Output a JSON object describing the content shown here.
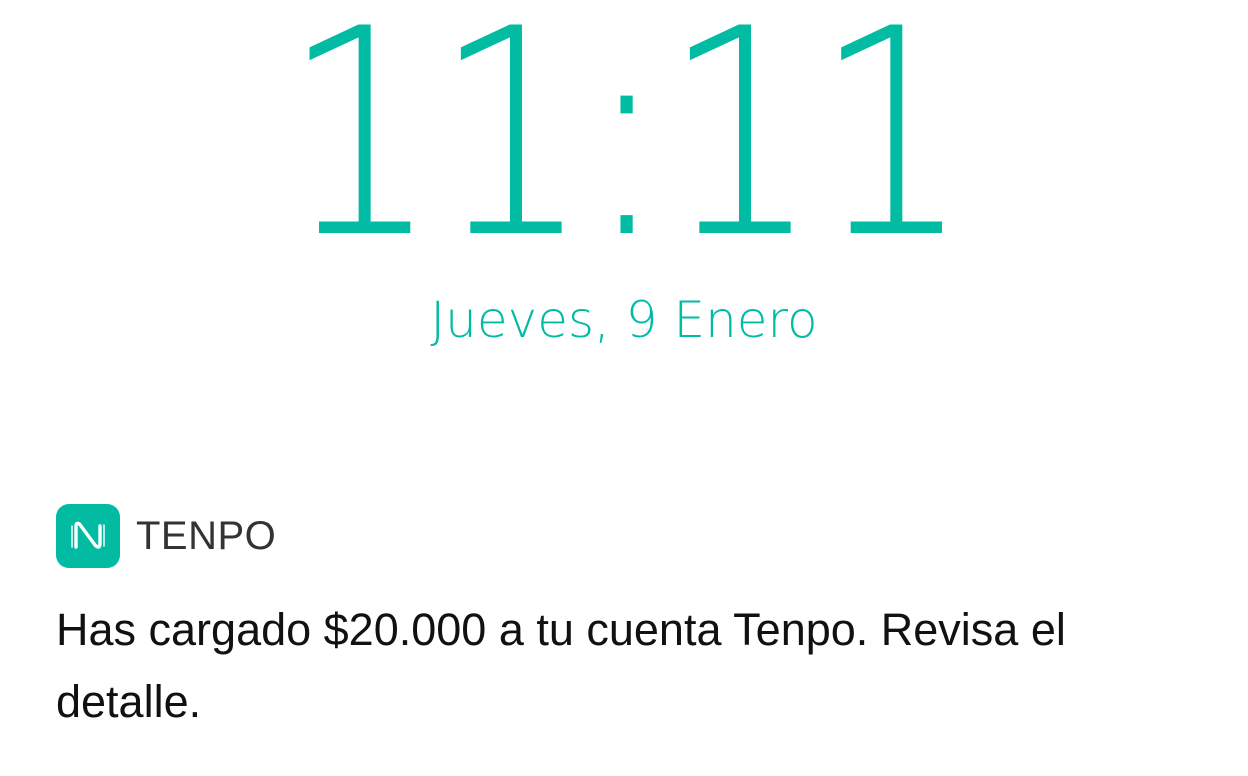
{
  "lock_screen": {
    "time": "11:11",
    "date": "Jueves, 9 Enero",
    "accent_color": "#02bba3"
  },
  "notification": {
    "app_icon": "tenpo-logo-icon",
    "app_name": "TENPO",
    "message": "Has cargado $20.000 a tu cuenta Tenpo. Revisa el detalle."
  }
}
